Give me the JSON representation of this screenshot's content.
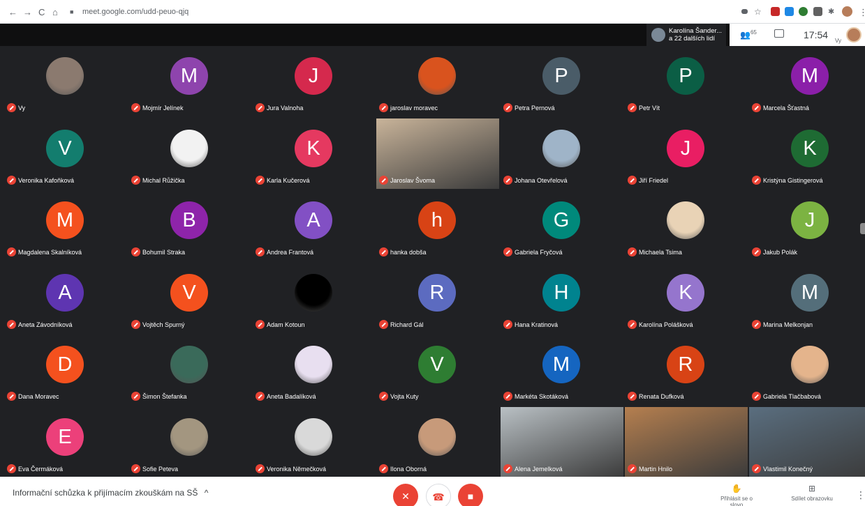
{
  "browser": {
    "url": "meet.google.com/udd-peuo-qjq",
    "nav_back": "←",
    "nav_forward": "→",
    "nav_reload": "C",
    "nav_home": "⌂",
    "lock": "🔒"
  },
  "topbar": {
    "presenter_line1": "Karolína Šander...",
    "presenter_line2": "a 22 dalších lidí",
    "participant_count": "65",
    "time": "17:54",
    "me_label": "Vy"
  },
  "tiles": [
    {
      "name": "Vy",
      "type": "photo",
      "color": "#8b7a6f"
    },
    {
      "name": "Mojmír Jelínek",
      "type": "letter",
      "letter": "M",
      "color": "#8e44ad"
    },
    {
      "name": "Jura Valnoha",
      "type": "letter",
      "letter": "J",
      "color": "#d5294d"
    },
    {
      "name": "jaroslav moravec",
      "type": "photo",
      "color": "#d9531e"
    },
    {
      "name": "Petra Pernová",
      "type": "letter",
      "letter": "P",
      "color": "#4a5c68"
    },
    {
      "name": "Petr Vít",
      "type": "letter",
      "letter": "P",
      "color": "#0b5e45"
    },
    {
      "name": "Marcela Šťastná",
      "type": "letter",
      "letter": "M",
      "color": "#8b1fa9"
    },
    {
      "name": "Veronika Kafoňková",
      "type": "letter",
      "letter": "V",
      "color": "#137d6e"
    },
    {
      "name": "Michal Růžička",
      "type": "photo",
      "color": "#f2f2f2"
    },
    {
      "name": "Karla Kučerová",
      "type": "letter",
      "letter": "K",
      "color": "#e53960"
    },
    {
      "name": "Jaroslav Švoma",
      "type": "video",
      "color": "#c9b49a"
    },
    {
      "name": "Johana Otevřelová",
      "type": "photo",
      "color": "#9fb4c8"
    },
    {
      "name": "Jiří Friedel",
      "type": "letter",
      "letter": "J",
      "color": "#e91e63"
    },
    {
      "name": "Kristýna Gistingerová",
      "type": "letter",
      "letter": "K",
      "color": "#1e6b33"
    },
    {
      "name": "Magdalena Skalníková",
      "type": "letter",
      "letter": "M",
      "color": "#f4511e"
    },
    {
      "name": "Bohumil Straka",
      "type": "letter",
      "letter": "B",
      "color": "#8e24aa"
    },
    {
      "name": "Andrea Frantová",
      "type": "letter",
      "letter": "A",
      "color": "#8250c4"
    },
    {
      "name": "hanka dobša",
      "type": "letter",
      "letter": "h",
      "color": "#d84315"
    },
    {
      "name": "Gabriela Fryčová",
      "type": "letter",
      "letter": "G",
      "color": "#00897b"
    },
    {
      "name": "Michaela Tsima",
      "type": "photo",
      "color": "#e9d3b6"
    },
    {
      "name": "Jakub Polák",
      "type": "letter",
      "letter": "J",
      "color": "#7cb342"
    },
    {
      "name": "Aneta Závodníková",
      "type": "letter",
      "letter": "A",
      "color": "#5e35b1"
    },
    {
      "name": "Vojtěch Spurný",
      "type": "letter",
      "letter": "V",
      "color": "#f4511e"
    },
    {
      "name": "Adam Kotoun",
      "type": "photo",
      "color": "#000000"
    },
    {
      "name": "Richard Gál",
      "type": "letter",
      "letter": "R",
      "color": "#5c6bc0"
    },
    {
      "name": "Hana Kratinová",
      "type": "letter",
      "letter": "H",
      "color": "#00838f"
    },
    {
      "name": "Karolína Polášková",
      "type": "letter",
      "letter": "K",
      "color": "#9575cd"
    },
    {
      "name": "Marina Melkonjan",
      "type": "letter",
      "letter": "M",
      "color": "#546e7a"
    },
    {
      "name": "Dana Moravec",
      "type": "letter",
      "letter": "D",
      "color": "#f4511e"
    },
    {
      "name": "Šimon Štefanka",
      "type": "photo",
      "color": "#3a6a5a"
    },
    {
      "name": "Aneta Badalíková",
      "type": "photo",
      "color": "#e8dff0"
    },
    {
      "name": "Vojta Kuty",
      "type": "letter",
      "letter": "V",
      "color": "#2e7d32"
    },
    {
      "name": "Markéta Skotáková",
      "type": "letter",
      "letter": "M",
      "color": "#1565c0"
    },
    {
      "name": "Renata Dufková",
      "type": "letter",
      "letter": "R",
      "color": "#d84315"
    },
    {
      "name": "Gabriela Tlačbabová",
      "type": "photo",
      "color": "#e4b48c"
    },
    {
      "name": "Eva Čermáková",
      "type": "letter",
      "letter": "E",
      "color": "#ec407a"
    },
    {
      "name": "Sofie Peteva",
      "type": "photo",
      "color": "#a39680"
    },
    {
      "name": "Veronika Němečková",
      "type": "photo",
      "color": "#d9d9d9"
    },
    {
      "name": "Ilona Oborná",
      "type": "photo",
      "color": "#c79a7a"
    },
    {
      "name": "Alena Jemelková",
      "type": "video",
      "color": "#b9c0c4"
    },
    {
      "name": "Martin Hnilo",
      "type": "video",
      "color": "#b57f4f"
    },
    {
      "name": "Vlastimil Konečný",
      "type": "video",
      "color": "#5a6e7f"
    }
  ],
  "bottombar": {
    "meeting_title": "Informační schůzka k přijímacím zkouškám na SŠ",
    "caret": "^",
    "raise_hand_label": "Přihlásit se o slovo",
    "present_label": "Sdílet obrazovku",
    "more": "⋮"
  }
}
